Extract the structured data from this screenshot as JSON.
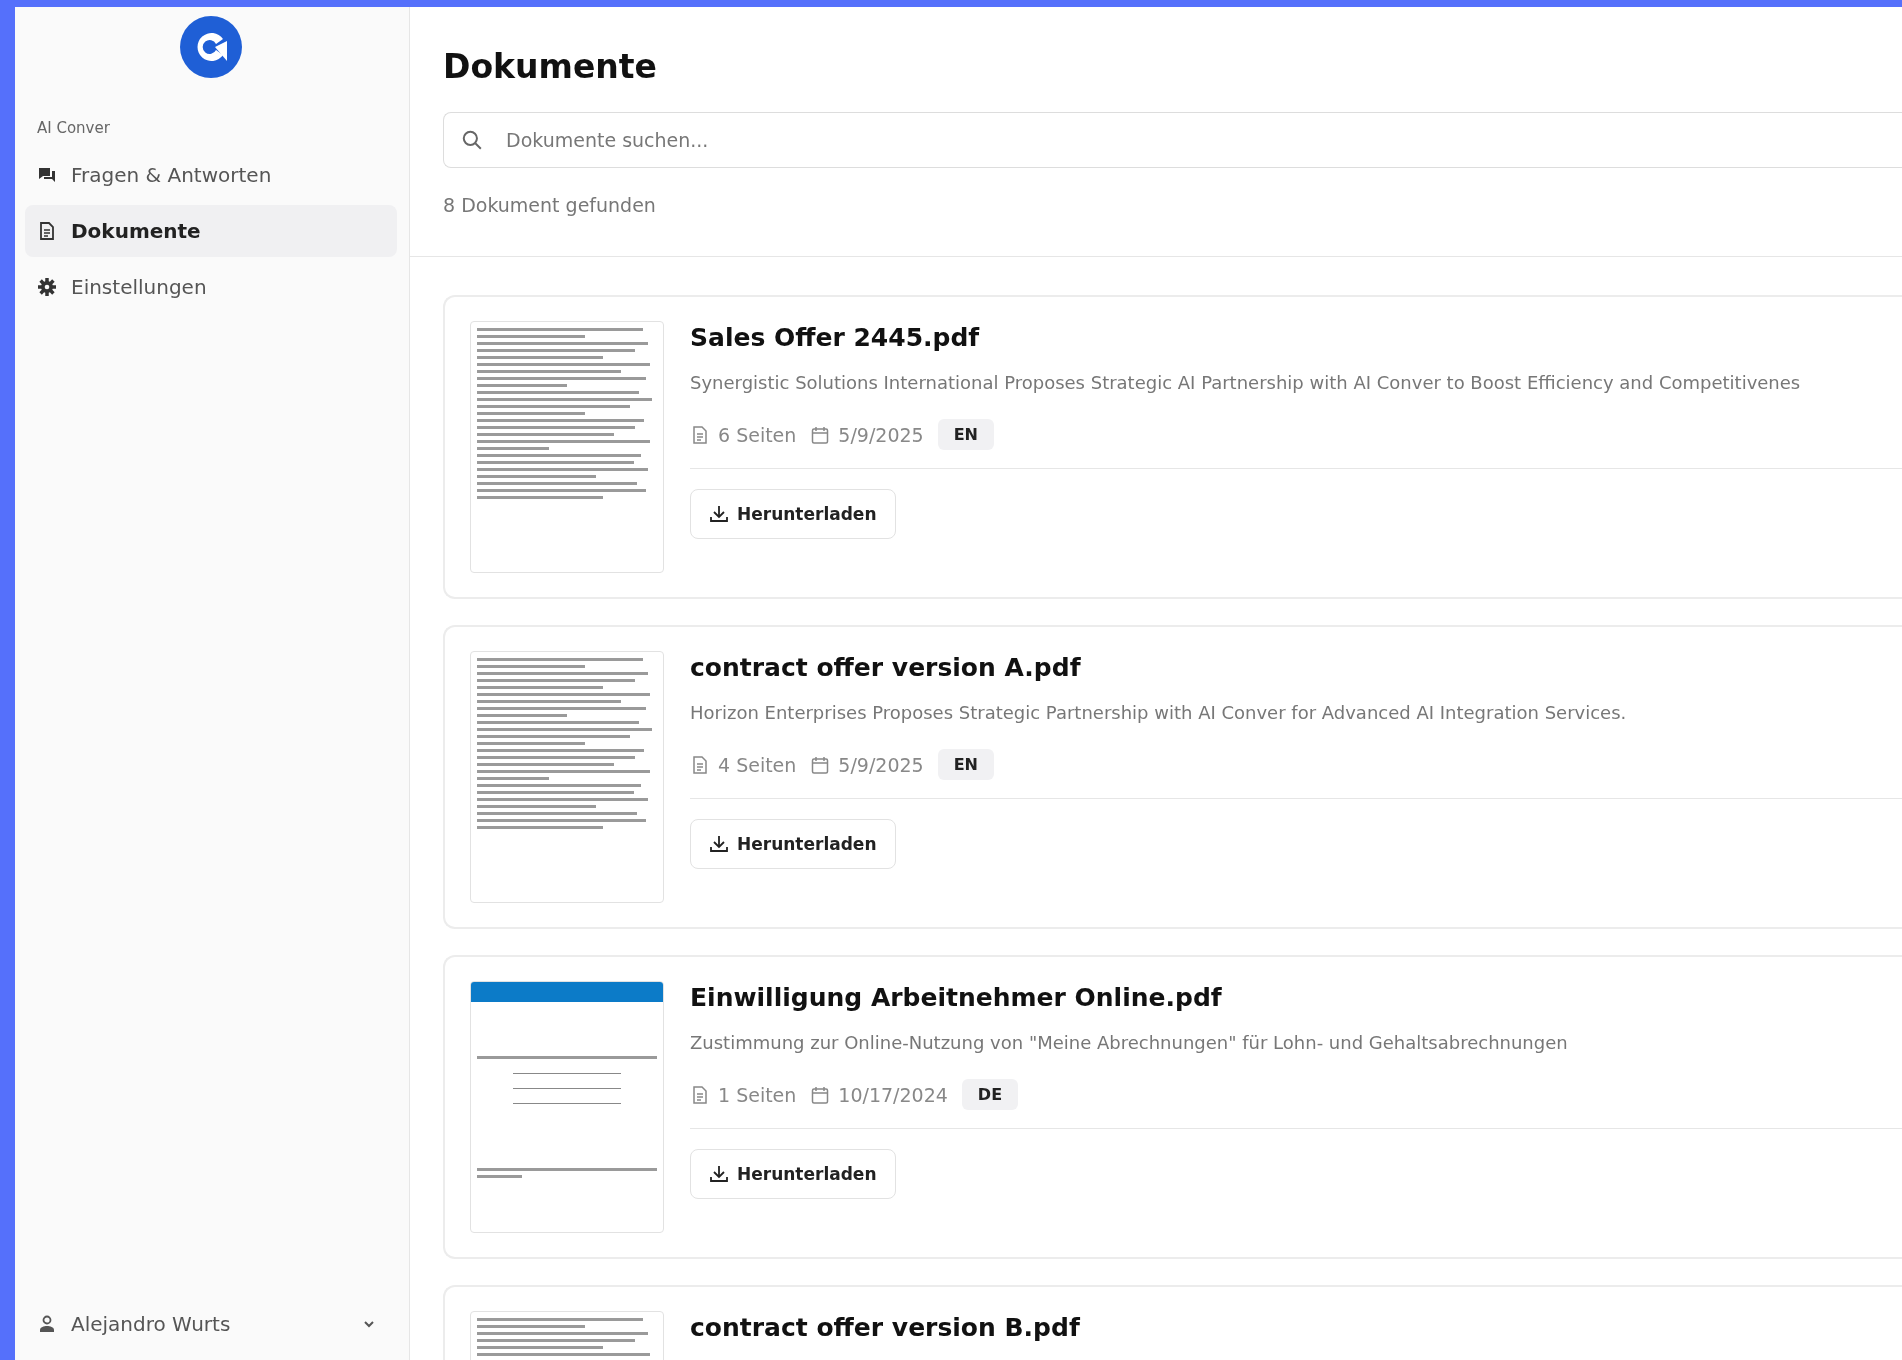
{
  "sidebar": {
    "brand": "AI Conver",
    "items": [
      {
        "label": "Fragen & Antworten",
        "selected": false
      },
      {
        "label": "Dokumente",
        "selected": true
      },
      {
        "label": "Einstellungen",
        "selected": false
      }
    ],
    "user": {
      "name": "Alejandro Wurts"
    }
  },
  "main": {
    "title": "Dokumente",
    "search": {
      "placeholder": "Dokumente suchen..."
    },
    "result_count": "8 Dokument gefunden",
    "documents": [
      {
        "title": "Sales Offer 2445.pdf",
        "description": "Synergistic Solutions International Proposes Strategic AI Partnership with AI Conver to Boost Efficiency and Competitivenes",
        "pages": "6 Seiten",
        "date": "5/9/2025",
        "language": "EN",
        "button": "Herunterladen"
      },
      {
        "title": "contract offer version A.pdf",
        "description": "Horizon Enterprises Proposes Strategic Partnership with AI Conver for Advanced AI Integration Services.",
        "pages": "4 Seiten",
        "date": "5/9/2025",
        "language": "EN",
        "button": "Herunterladen"
      },
      {
        "title": "Einwilligung Arbeitnehmer Online.pdf",
        "description": "Zustimmung zur Online-Nutzung von \"Meine Abrechnungen\" für Lohn- und Gehaltsabrechnungen",
        "pages": "1 Seiten",
        "date": "10/17/2024",
        "language": "DE",
        "button": "Herunterladen"
      },
      {
        "title": "contract offer version B.pdf"
      }
    ]
  }
}
